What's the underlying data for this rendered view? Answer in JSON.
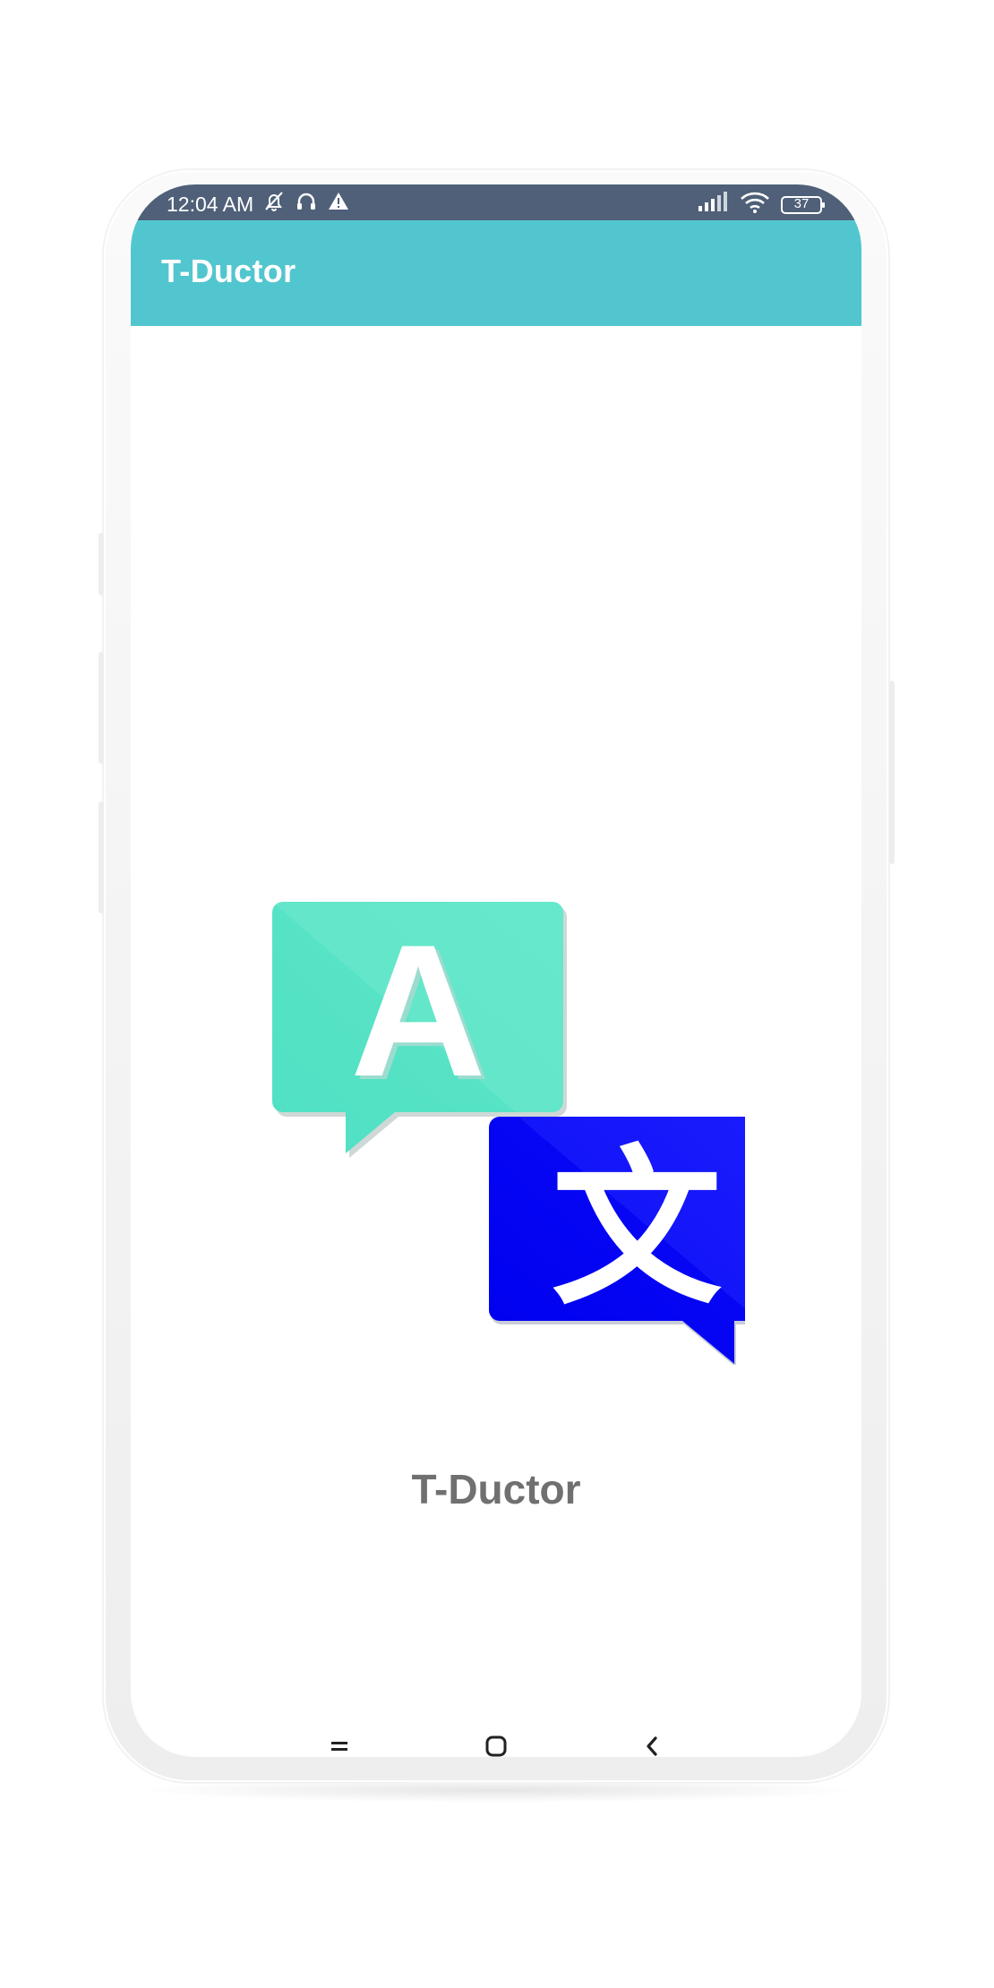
{
  "status_bar": {
    "time": "12:04 AM",
    "battery": "37",
    "icons": [
      "muted-bell-icon",
      "headphones-icon",
      "warning-icon",
      "signal-icon",
      "wifi-icon",
      "battery-icon"
    ]
  },
  "app_bar": {
    "title": "T-Ductor"
  },
  "splash": {
    "logo_letter_latin": "A",
    "logo_letter_cjk": "文",
    "title": "T-Ductor"
  },
  "nav_bar": {
    "icons": [
      "recents-icon",
      "home-icon",
      "back-icon"
    ]
  },
  "colors": {
    "status_bar": "#4f6078",
    "app_bar": "#52c6cf",
    "bubble_a": "#5ee3c4",
    "bubble_b": "#0a10f5",
    "title_text": "#707070"
  }
}
